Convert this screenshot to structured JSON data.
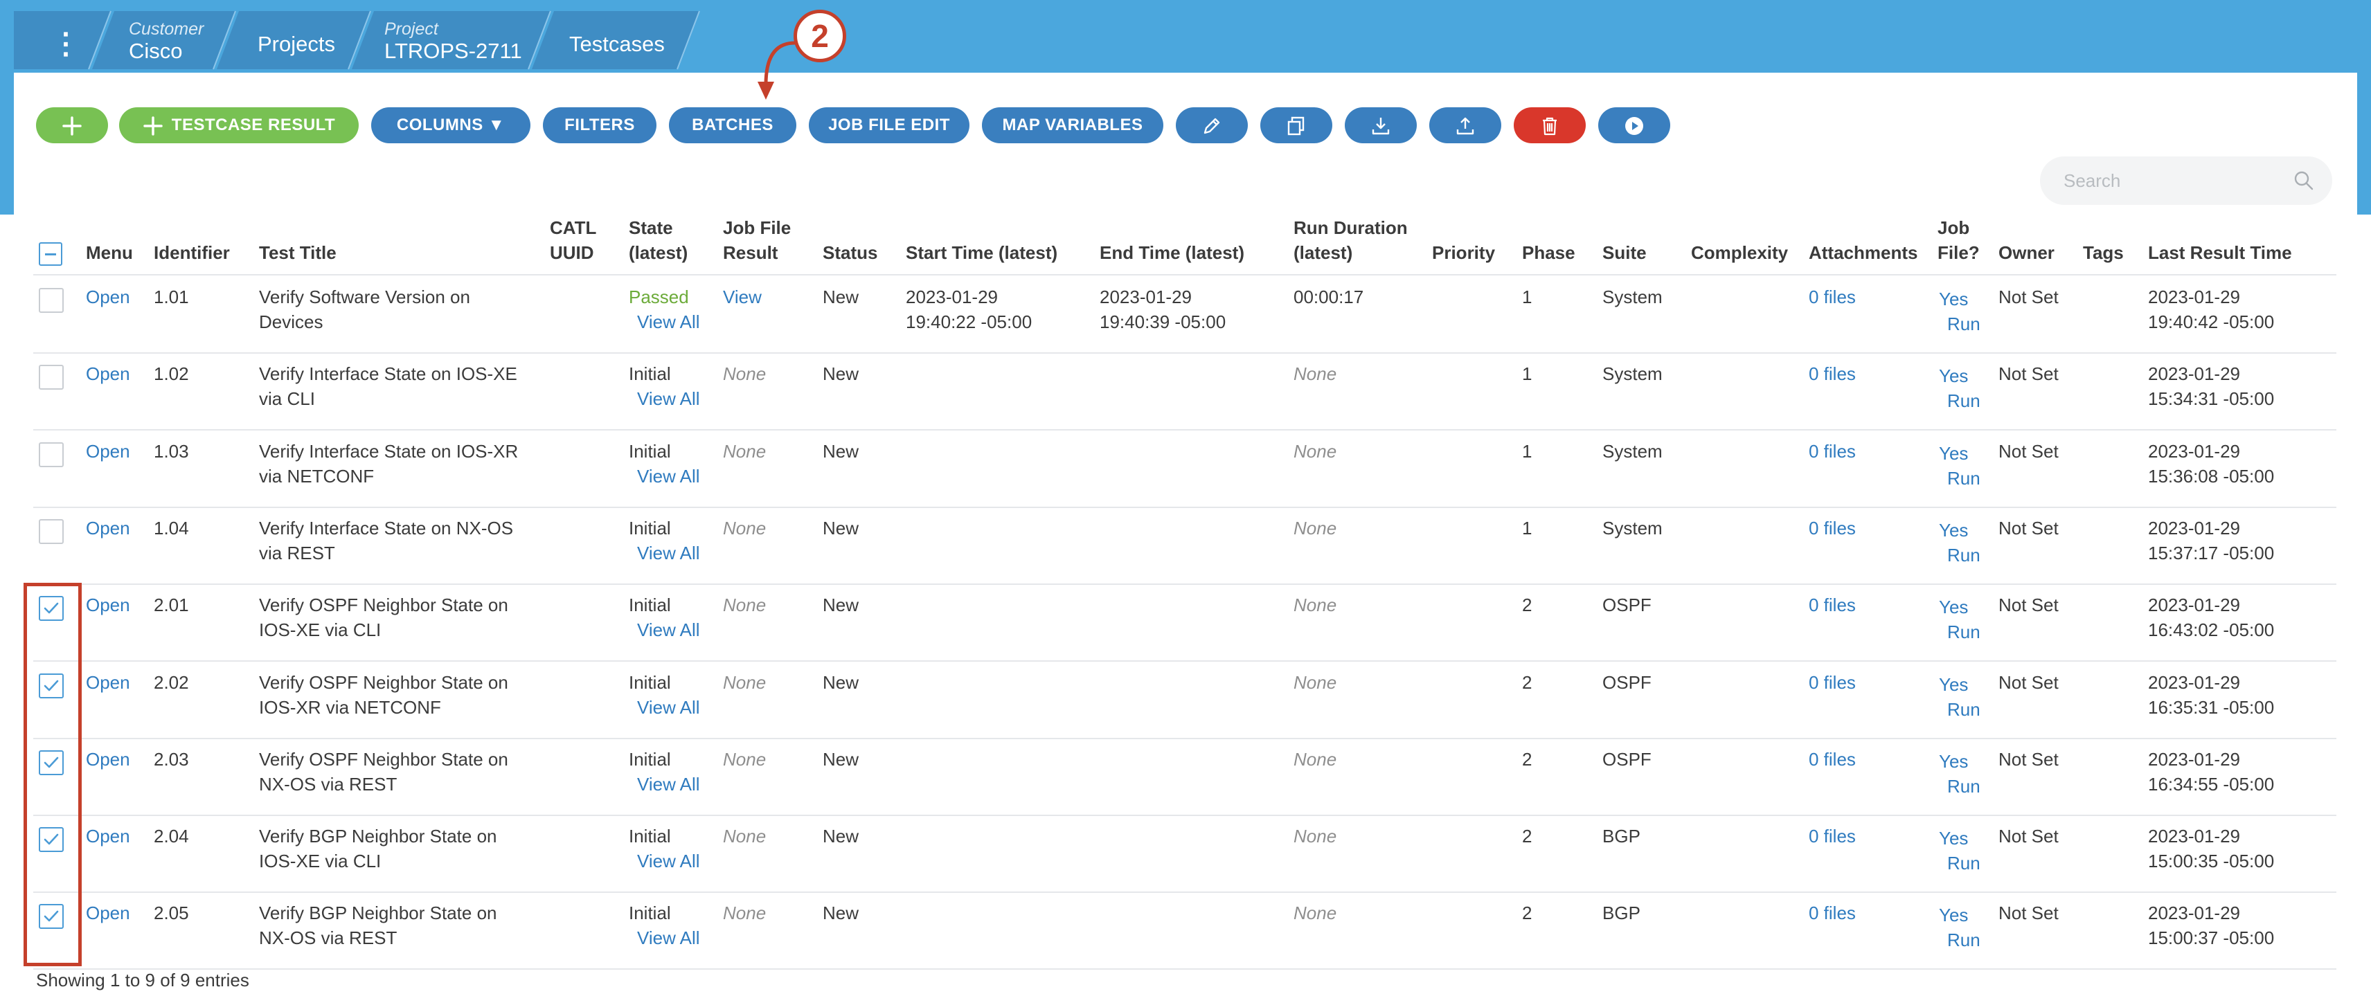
{
  "breadcrumb": {
    "menu_glyph": "⋮",
    "customer_label": "Customer",
    "customer_value": "Cisco",
    "projects": "Projects",
    "project_label": "Project",
    "project_value": "LTROPS-2711",
    "testcases": "Testcases"
  },
  "annotation": {
    "number": "2"
  },
  "toolbar": {
    "add_icon": "plus-icon",
    "testcase_result": "TESTCASE RESULT",
    "columns": "COLUMNS ▼",
    "filters": "FILTERS",
    "batches": "BATCHES",
    "job_file_edit": "JOB FILE EDIT",
    "map_variables": "MAP VARIABLES",
    "icons": [
      "pencil-icon",
      "copy-icon",
      "download-icon",
      "upload-icon",
      "trash-icon",
      "play-icon"
    ],
    "colors": {
      "blue": "#3a7fbf",
      "green": "#78c153",
      "red": "#d9372b",
      "header": "#4ba7dd"
    }
  },
  "search": {
    "placeholder": "Search"
  },
  "table": {
    "headers": {
      "menu": "Menu",
      "identifier": "Identifier",
      "test_title": "Test Title",
      "catl_1": "CATL",
      "catl_2": "UUID",
      "state_1": "State",
      "state_2": "(latest)",
      "jobfile_1": "Job File",
      "jobfile_2": "Result",
      "status": "Status",
      "start_time": "Start Time (latest)",
      "end_time": "End Time (latest)",
      "duration_1": "Run Duration",
      "duration_2": "(latest)",
      "priority": "Priority",
      "phase": "Phase",
      "suite": "Suite",
      "complexity": "Complexity",
      "attachments": "Attachments",
      "jobfileq_1": "Job",
      "jobfileq_2": "File?",
      "owner": "Owner",
      "tags": "Tags",
      "last_result": "Last Result Time"
    },
    "rows": [
      {
        "checked": false,
        "menu": "Open",
        "id": "1.01",
        "title1": "Verify Software Version on",
        "title2": "Devices",
        "state": "Passed",
        "state_passed": true,
        "view_all": "View All",
        "jf_result": "View",
        "jf_is_link": true,
        "status": "New",
        "start1": "2023-01-29",
        "start2": "19:40:22 -05:00",
        "end1": "2023-01-29",
        "end2": "19:40:39 -05:00",
        "duration": "00:00:17",
        "dur_none": false,
        "phase": "1",
        "suite": "System",
        "attachments": "0 files",
        "job_yes": "Yes",
        "job_run": "Run",
        "owner": "Not Set",
        "last1": "2023-01-29",
        "last2": "19:40:42 -05:00"
      },
      {
        "checked": false,
        "menu": "Open",
        "id": "1.02",
        "title1": "Verify Interface State on IOS-XE",
        "title2": "via CLI",
        "state": "Initial",
        "state_passed": false,
        "view_all": "View All",
        "jf_result": "None",
        "jf_is_link": false,
        "status": "New",
        "start1": "",
        "start2": "",
        "end1": "",
        "end2": "",
        "duration": "None",
        "dur_none": true,
        "phase": "1",
        "suite": "System",
        "attachments": "0 files",
        "job_yes": "Yes",
        "job_run": "Run",
        "owner": "Not Set",
        "last1": "2023-01-29",
        "last2": "15:34:31 -05:00"
      },
      {
        "checked": false,
        "menu": "Open",
        "id": "1.03",
        "title1": "Verify Interface State on IOS-XR",
        "title2": "via NETCONF",
        "state": "Initial",
        "state_passed": false,
        "view_all": "View All",
        "jf_result": "None",
        "jf_is_link": false,
        "status": "New",
        "start1": "",
        "start2": "",
        "end1": "",
        "end2": "",
        "duration": "None",
        "dur_none": true,
        "phase": "1",
        "suite": "System",
        "attachments": "0 files",
        "job_yes": "Yes",
        "job_run": "Run",
        "owner": "Not Set",
        "last1": "2023-01-29",
        "last2": "15:36:08 -05:00"
      },
      {
        "checked": false,
        "menu": "Open",
        "id": "1.04",
        "title1": "Verify Interface State on NX-OS",
        "title2": "via REST",
        "state": "Initial",
        "state_passed": false,
        "view_all": "View All",
        "jf_result": "None",
        "jf_is_link": false,
        "status": "New",
        "start1": "",
        "start2": "",
        "end1": "",
        "end2": "",
        "duration": "None",
        "dur_none": true,
        "phase": "1",
        "suite": "System",
        "attachments": "0 files",
        "job_yes": "Yes",
        "job_run": "Run",
        "owner": "Not Set",
        "last1": "2023-01-29",
        "last2": "15:37:17 -05:00"
      },
      {
        "checked": true,
        "menu": "Open",
        "id": "2.01",
        "title1": "Verify OSPF Neighbor State on",
        "title2": "IOS-XE via CLI",
        "state": "Initial",
        "state_passed": false,
        "view_all": "View All",
        "jf_result": "None",
        "jf_is_link": false,
        "status": "New",
        "start1": "",
        "start2": "",
        "end1": "",
        "end2": "",
        "duration": "None",
        "dur_none": true,
        "phase": "2",
        "suite": "OSPF",
        "attachments": "0 files",
        "job_yes": "Yes",
        "job_run": "Run",
        "owner": "Not Set",
        "last1": "2023-01-29",
        "last2": "16:43:02 -05:00"
      },
      {
        "checked": true,
        "menu": "Open",
        "id": "2.02",
        "title1": "Verify OSPF Neighbor State on",
        "title2": "IOS-XR via NETCONF",
        "state": "Initial",
        "state_passed": false,
        "view_all": "View All",
        "jf_result": "None",
        "jf_is_link": false,
        "status": "New",
        "start1": "",
        "start2": "",
        "end1": "",
        "end2": "",
        "duration": "None",
        "dur_none": true,
        "phase": "2",
        "suite": "OSPF",
        "attachments": "0 files",
        "job_yes": "Yes",
        "job_run": "Run",
        "owner": "Not Set",
        "last1": "2023-01-29",
        "last2": "16:35:31 -05:00"
      },
      {
        "checked": true,
        "menu": "Open",
        "id": "2.03",
        "title1": "Verify OSPF Neighbor State on",
        "title2": "NX-OS via REST",
        "state": "Initial",
        "state_passed": false,
        "view_all": "View All",
        "jf_result": "None",
        "jf_is_link": false,
        "status": "New",
        "start1": "",
        "start2": "",
        "end1": "",
        "end2": "",
        "duration": "None",
        "dur_none": true,
        "phase": "2",
        "suite": "OSPF",
        "attachments": "0 files",
        "job_yes": "Yes",
        "job_run": "Run",
        "owner": "Not Set",
        "last1": "2023-01-29",
        "last2": "16:34:55 -05:00"
      },
      {
        "checked": true,
        "menu": "Open",
        "id": "2.04",
        "title1": "Verify BGP Neighbor State on",
        "title2": "IOS-XE via CLI",
        "state": "Initial",
        "state_passed": false,
        "view_all": "View All",
        "jf_result": "None",
        "jf_is_link": false,
        "status": "New",
        "start1": "",
        "start2": "",
        "end1": "",
        "end2": "",
        "duration": "None",
        "dur_none": true,
        "phase": "2",
        "suite": "BGP",
        "attachments": "0 files",
        "job_yes": "Yes",
        "job_run": "Run",
        "owner": "Not Set",
        "last1": "2023-01-29",
        "last2": "15:00:35 -05:00"
      },
      {
        "checked": true,
        "menu": "Open",
        "id": "2.05",
        "title1": "Verify BGP Neighbor State on",
        "title2": "NX-OS via REST",
        "state": "Initial",
        "state_passed": false,
        "view_all": "View All",
        "jf_result": "None",
        "jf_is_link": false,
        "status": "New",
        "start1": "",
        "start2": "",
        "end1": "",
        "end2": "",
        "duration": "None",
        "dur_none": true,
        "phase": "2",
        "suite": "BGP",
        "attachments": "0 files",
        "job_yes": "Yes",
        "job_run": "Run",
        "owner": "Not Set",
        "last1": "2023-01-29",
        "last2": "15:00:37 -05:00"
      }
    ]
  },
  "footer": {
    "entries": "Showing 1 to 9 of 9 entries"
  }
}
